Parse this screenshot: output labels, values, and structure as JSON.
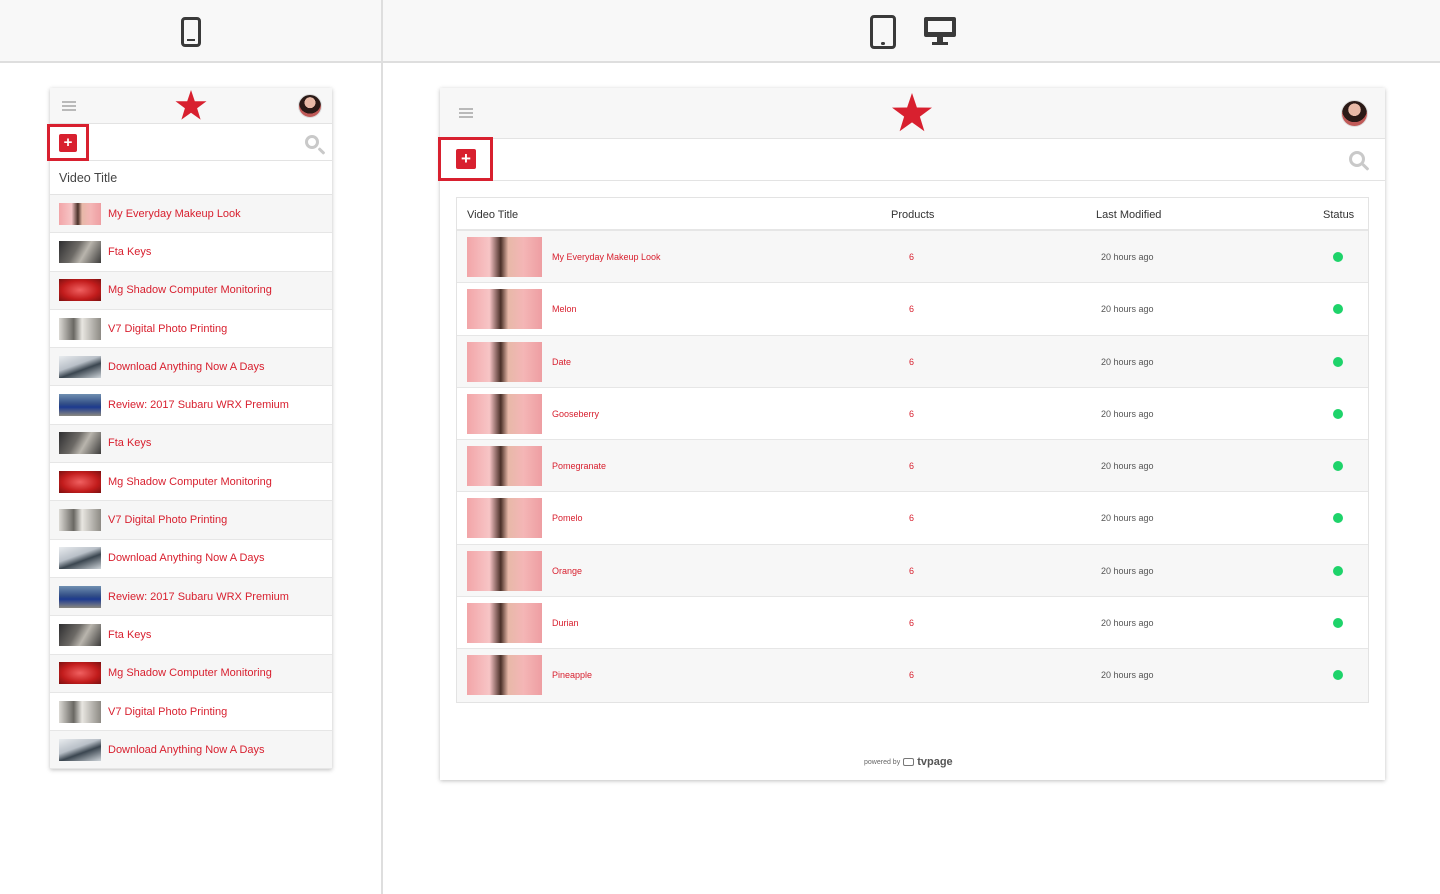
{
  "device_bar": {
    "icons": [
      "phone-icon",
      "tablet-icon",
      "desktop-icon"
    ]
  },
  "brand_color": "#d8202f",
  "status_color": "#1ed36a",
  "mobile": {
    "column_header": "Video Title",
    "rows": [
      {
        "title": "My Everyday Makeup Look",
        "thumb": "makeup"
      },
      {
        "title": "Fta Keys",
        "thumb": "dark"
      },
      {
        "title": "Mg Shadow Computer Monitoring",
        "thumb": "red"
      },
      {
        "title": "V7 Digital Photo Printing",
        "thumb": "print"
      },
      {
        "title": "Download Anything Now A Days",
        "thumb": "dl"
      },
      {
        "title": "Review: 2017 Subaru WRX Premium",
        "thumb": "car"
      },
      {
        "title": "Fta Keys",
        "thumb": "dark"
      },
      {
        "title": "Mg Shadow Computer Monitoring",
        "thumb": "red"
      },
      {
        "title": "V7 Digital Photo Printing",
        "thumb": "print"
      },
      {
        "title": "Download Anything Now A Days",
        "thumb": "dl"
      },
      {
        "title": "Review: 2017 Subaru WRX Premium",
        "thumb": "car"
      },
      {
        "title": "Fta Keys",
        "thumb": "dark"
      },
      {
        "title": "Mg Shadow Computer Monitoring",
        "thumb": "red"
      },
      {
        "title": "V7 Digital Photo Printing",
        "thumb": "print"
      },
      {
        "title": "Download Anything Now A Days",
        "thumb": "dl"
      }
    ]
  },
  "desktop": {
    "columns": {
      "title": "Video Title",
      "products": "Products",
      "modified": "Last Modified",
      "status": "Status"
    },
    "rows": [
      {
        "title": "My Everyday Makeup Look",
        "products": "6",
        "modified": "20 hours ago",
        "status": "active"
      },
      {
        "title": "Melon",
        "products": "6",
        "modified": "20 hours ago",
        "status": "active"
      },
      {
        "title": "Date",
        "products": "6",
        "modified": "20 hours ago",
        "status": "active"
      },
      {
        "title": "Gooseberry",
        "products": "6",
        "modified": "20 hours ago",
        "status": "active"
      },
      {
        "title": "Pomegranate",
        "products": "6",
        "modified": "20 hours ago",
        "status": "active"
      },
      {
        "title": "Pomelo",
        "products": "6",
        "modified": "20 hours ago",
        "status": "active"
      },
      {
        "title": "Orange",
        "products": "6",
        "modified": "20 hours ago",
        "status": "active"
      },
      {
        "title": "Durian",
        "products": "6",
        "modified": "20 hours ago",
        "status": "active"
      },
      {
        "title": "Pineapple",
        "products": "6",
        "modified": "20 hours ago",
        "status": "active"
      }
    ],
    "footer": {
      "powered_by": "powered by",
      "brand": "tvpage"
    }
  }
}
